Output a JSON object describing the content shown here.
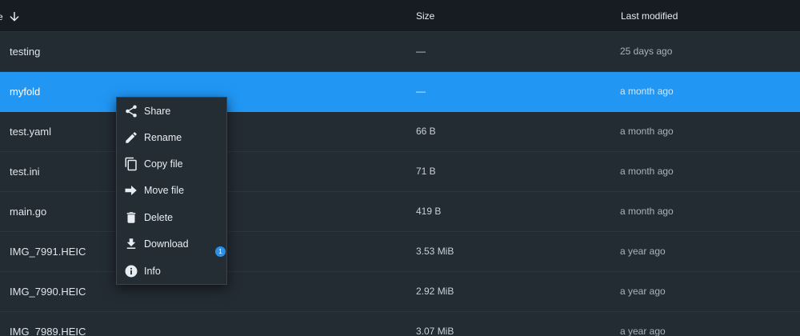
{
  "header": {
    "name_label": "e",
    "size_label": "Size",
    "modified_label": "Last modified"
  },
  "rows": [
    {
      "name": "testing",
      "size": "—",
      "modified": "25 days ago",
      "selected": false
    },
    {
      "name": "myfold",
      "size": "—",
      "modified": "a month ago",
      "selected": true
    },
    {
      "name": "test.yaml",
      "size": "66 B",
      "modified": "a month ago",
      "selected": false
    },
    {
      "name": "test.ini",
      "size": "71 B",
      "modified": "a month ago",
      "selected": false
    },
    {
      "name": "main.go",
      "size": "419 B",
      "modified": "a month ago",
      "selected": false
    },
    {
      "name": "IMG_7991.HEIC",
      "size": "3.53 MiB",
      "modified": "a year ago",
      "selected": false
    },
    {
      "name": "IMG_7990.HEIC",
      "size": "2.92 MiB",
      "modified": "a year ago",
      "selected": false
    },
    {
      "name": "IMG_7989.HEIC",
      "size": "3.07 MiB",
      "modified": "a year ago",
      "selected": false
    }
  ],
  "context_menu": {
    "items": [
      {
        "label": "Share",
        "icon": "share-icon"
      },
      {
        "label": "Rename",
        "icon": "pencil-icon"
      },
      {
        "label": "Copy file",
        "icon": "copy-icon"
      },
      {
        "label": "Move file",
        "icon": "arrow-right-icon"
      },
      {
        "label": "Delete",
        "icon": "trash-icon"
      },
      {
        "label": "Download",
        "icon": "download-icon"
      },
      {
        "label": "Info",
        "icon": "info-icon"
      }
    ],
    "download_badge": "1"
  },
  "colors": {
    "background": "#1e252c",
    "header": "#161c22",
    "selected_row": "#2196f3",
    "badge": "#2d8fe6"
  }
}
